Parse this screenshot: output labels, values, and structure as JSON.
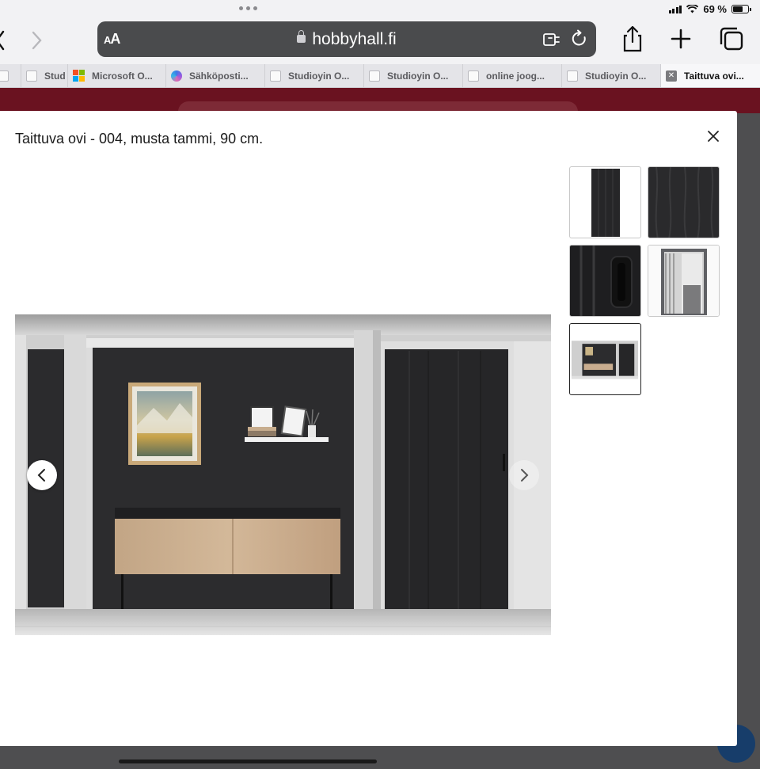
{
  "status": {
    "battery_label": "69 %",
    "battery_level": 0.69
  },
  "browser": {
    "text_size_label": "AA",
    "url": "hobbyhall.fi",
    "tabs": [
      {
        "label": "Stud",
        "favicon": "generic-page-icon"
      },
      {
        "label": "Microsoft O...",
        "favicon": "microsoft-logo-icon"
      },
      {
        "label": "Sähköposti...",
        "favicon": "copilot-icon"
      },
      {
        "label": "Studioyin O...",
        "favicon": "generic-page-icon"
      },
      {
        "label": "Studioyin O...",
        "favicon": "generic-page-icon"
      },
      {
        "label": "online joog...",
        "favicon": "generic-page-icon"
      },
      {
        "label": "Studioyin O...",
        "favicon": "generic-page-icon"
      },
      {
        "label": "Taittuva ovi...",
        "favicon": "close-icon",
        "active": true
      }
    ],
    "icons": [
      "back-icon",
      "forward-icon",
      "lock-icon",
      "extension-icon",
      "reload-icon",
      "share-icon",
      "new-tab-icon",
      "tabs-overview-icon"
    ]
  },
  "modal": {
    "title": "Taittuva ovi - 004, musta tammi, 90 cm.",
    "thumbnails": [
      "door-front",
      "wood-texture",
      "handle-closeup",
      "door-open",
      "room-scene"
    ],
    "selected_thumbnail": 4
  },
  "colors": {
    "brand_header": "#6a1220",
    "door": "#262628",
    "wall": "#2c2c2e",
    "sideboard_wood": "#c9ad8f"
  }
}
